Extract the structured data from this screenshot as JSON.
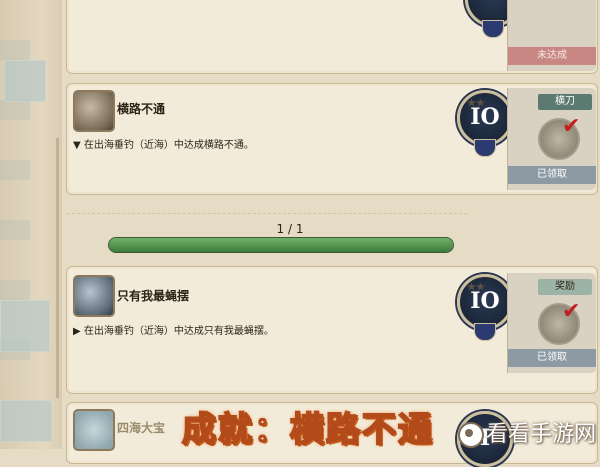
{
  "top_card": {
    "status": "未达成"
  },
  "achievement_1": {
    "title": "横路不通",
    "description": "▼ 在出海垂钓（近海）中达成横路不通。",
    "rank": "IO",
    "reward_label": "横刀",
    "status": "已领取"
  },
  "progress": {
    "text": "1 / 1",
    "current": 1,
    "total": 1
  },
  "achievement_2": {
    "title": "只有我最蝇摆",
    "description": "▶ 在出海垂钓（近海）中达成只有我最蝇摆。",
    "rank": "IO",
    "reward_label": "奖励",
    "status": "已领取"
  },
  "achievement_3": {
    "title": "四海大宝",
    "rank": "I"
  },
  "caption": "成就：横路不通",
  "watermark": "看看手游网",
  "stars": "★★"
}
